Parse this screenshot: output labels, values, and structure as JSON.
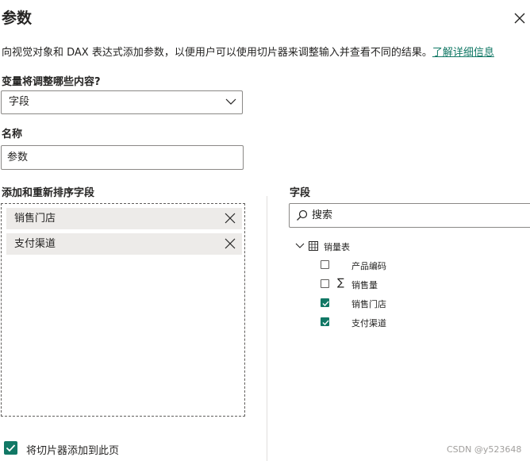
{
  "dialog": {
    "title": "参数",
    "description": "向视觉对象和 DAX 表达式添加参数，以便用户可以使用切片器来调整输入并查看不同的结果。",
    "learn_more": "了解详细信息"
  },
  "variable": {
    "label": "变量将调整哪些内容?",
    "selected": "字段"
  },
  "name": {
    "label": "名称",
    "value": "参数"
  },
  "reorder": {
    "label": "添加和重新排序字段",
    "chips": [
      {
        "label": "销售门店"
      },
      {
        "label": "支付渠道"
      }
    ]
  },
  "fields": {
    "label": "字段",
    "search_placeholder": "搜索",
    "table": {
      "name": "销量表",
      "expanded": true,
      "items": [
        {
          "label": "产品编码",
          "checked": false,
          "icon": ""
        },
        {
          "label": "销售量",
          "checked": false,
          "icon": "sigma-icon"
        },
        {
          "label": "销售门店",
          "checked": true,
          "icon": ""
        },
        {
          "label": "支付渠道",
          "checked": true,
          "icon": ""
        }
      ]
    }
  },
  "footer": {
    "add_slicer_label": "将切片器添加到此页",
    "add_slicer_checked": true
  },
  "watermark": "CSDN @y523648",
  "colors": {
    "accent": "#117865",
    "border": "#8a8886",
    "chip_bg": "#edebe9"
  }
}
